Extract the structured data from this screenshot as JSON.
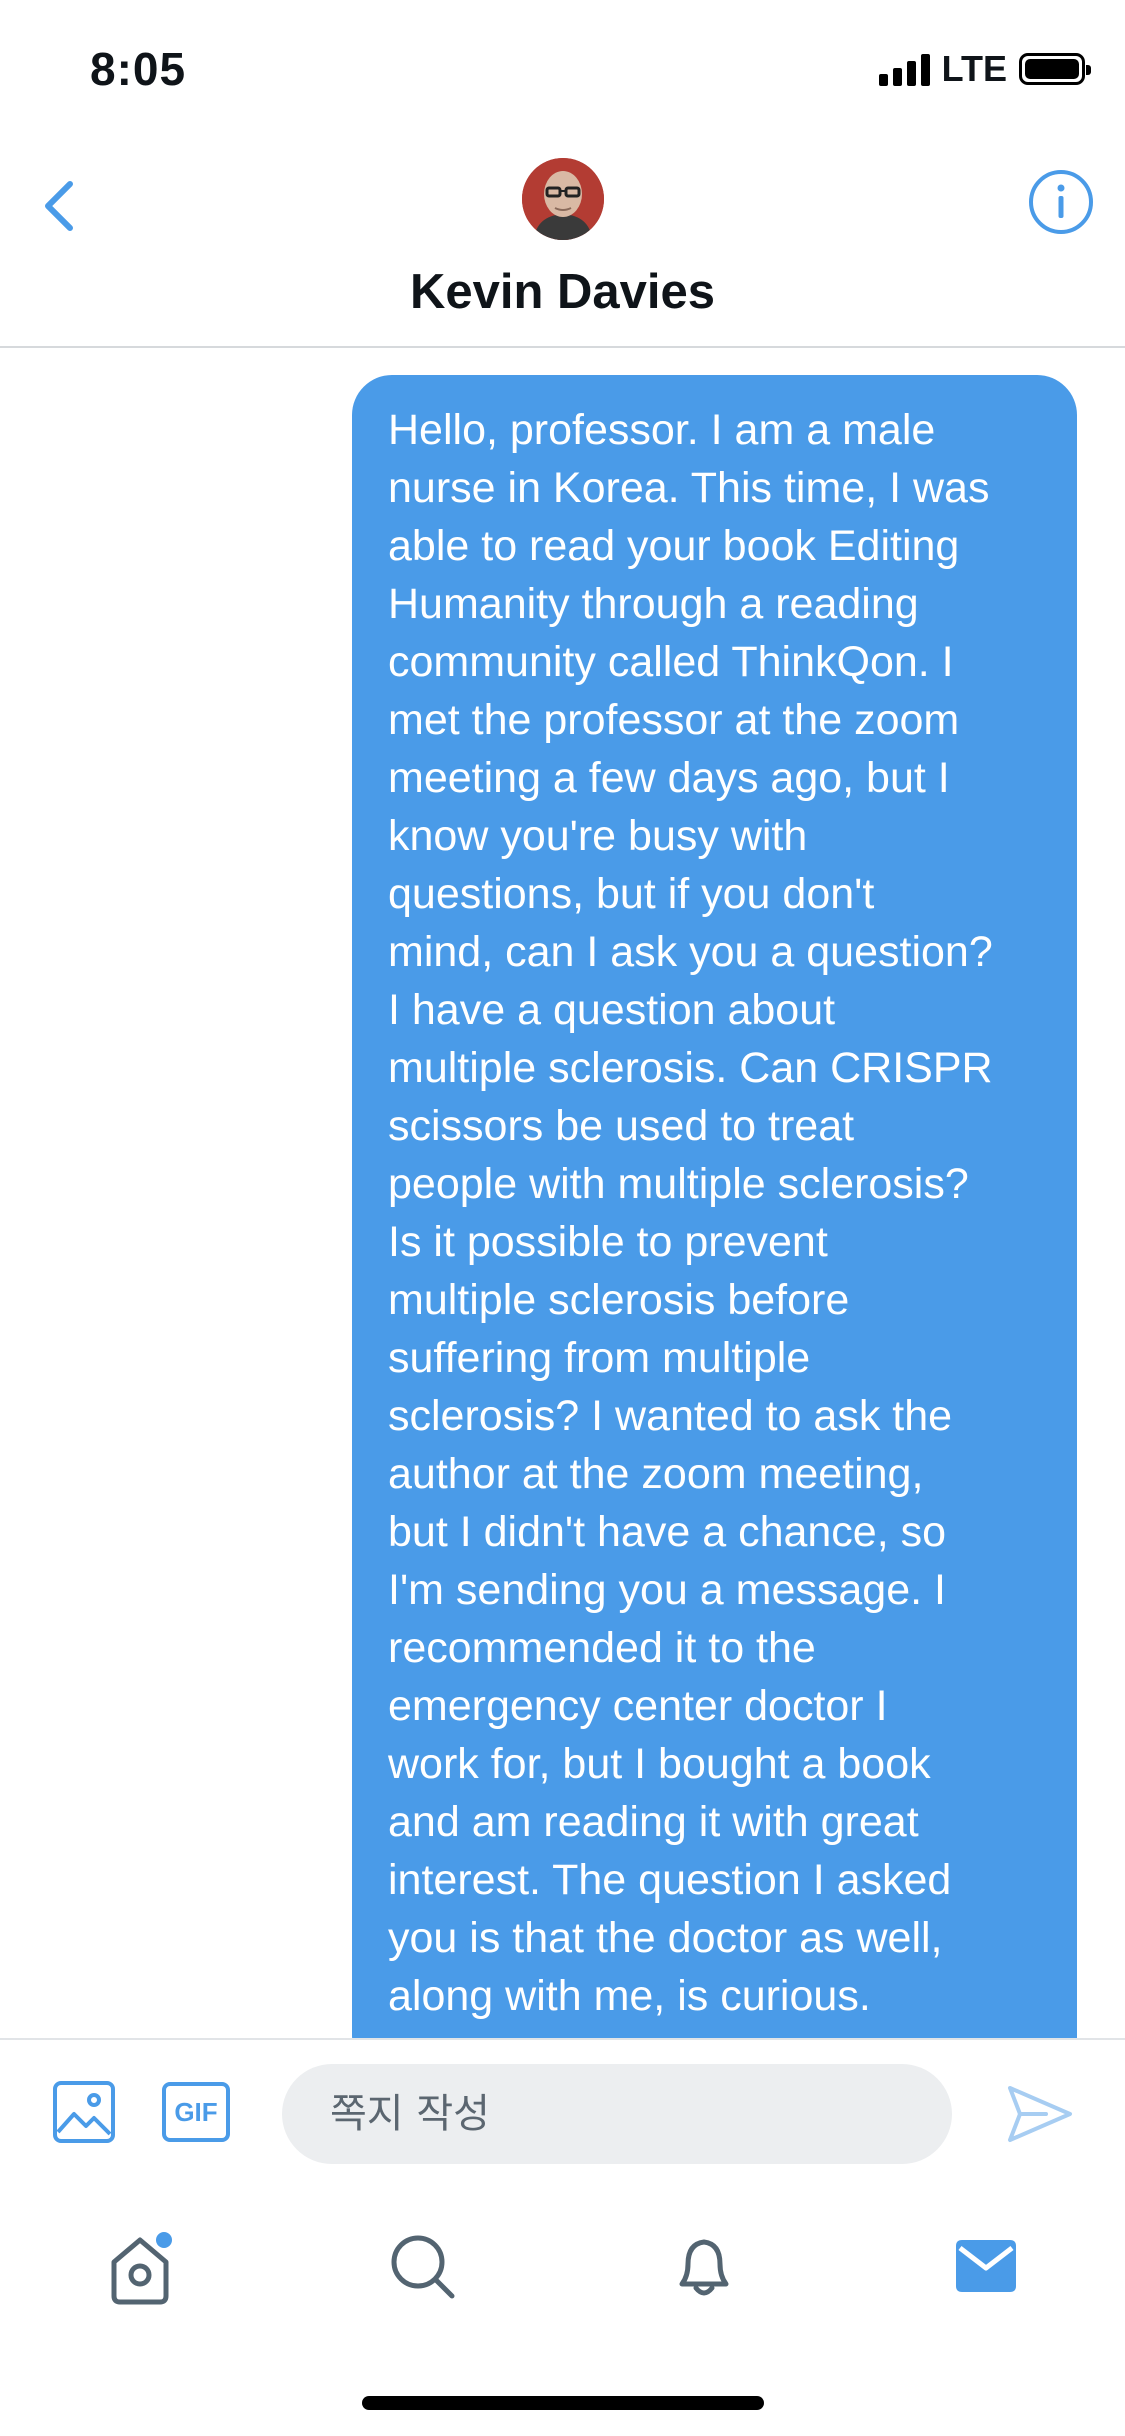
{
  "status_bar": {
    "time": "8:05",
    "network": "LTE"
  },
  "header": {
    "title": "Kevin Davies",
    "back_icon": "chevron-left-icon",
    "info_icon": "info-icon",
    "accent_color": "#4a9be8"
  },
  "conversation": {
    "messages": [
      {
        "direction": "outgoing",
        "lines": [
          "Hello, professor. I am a male",
          "nurse in Korea. This time, I was",
          "able to read your book Editing",
          "Humanity through a reading",
          "community called ThinkQon. I",
          "met the professor at the zoom",
          "meeting a few days ago, but I",
          "know you're busy with",
          "questions, but if you don't",
          "mind, can I ask you a question?",
          "I have a question about",
          "multiple sclerosis. Can CRISPR",
          "scissors be used to treat",
          "people with multiple sclerosis?",
          "Is it possible to prevent",
          "multiple sclerosis before",
          "suffering from multiple",
          "sclerosis? I wanted to ask the",
          "author at the zoom meeting,",
          "but I didn't have a chance, so",
          "I'm sending you a message. I",
          "recommended it to the",
          "emergency center doctor I",
          "work for, but I bought a book",
          "and am reading it with great",
          "interest. The question I asked",
          "you is that the doctor as well,",
          "along with me, is curious."
        ],
        "bubble_color": "#4a9be8"
      }
    ]
  },
  "composer": {
    "placeholder": "쪽지 작성",
    "media_icon": "image-icon",
    "gif_label": "GIF",
    "send_icon": "send-icon"
  },
  "tabbar": {
    "items": [
      {
        "name": "home",
        "icon": "home-icon",
        "has_notification_dot": true
      },
      {
        "name": "search",
        "icon": "search-icon"
      },
      {
        "name": "notifications",
        "icon": "bell-icon"
      },
      {
        "name": "messages",
        "icon": "mail-icon",
        "active": true
      }
    ]
  }
}
